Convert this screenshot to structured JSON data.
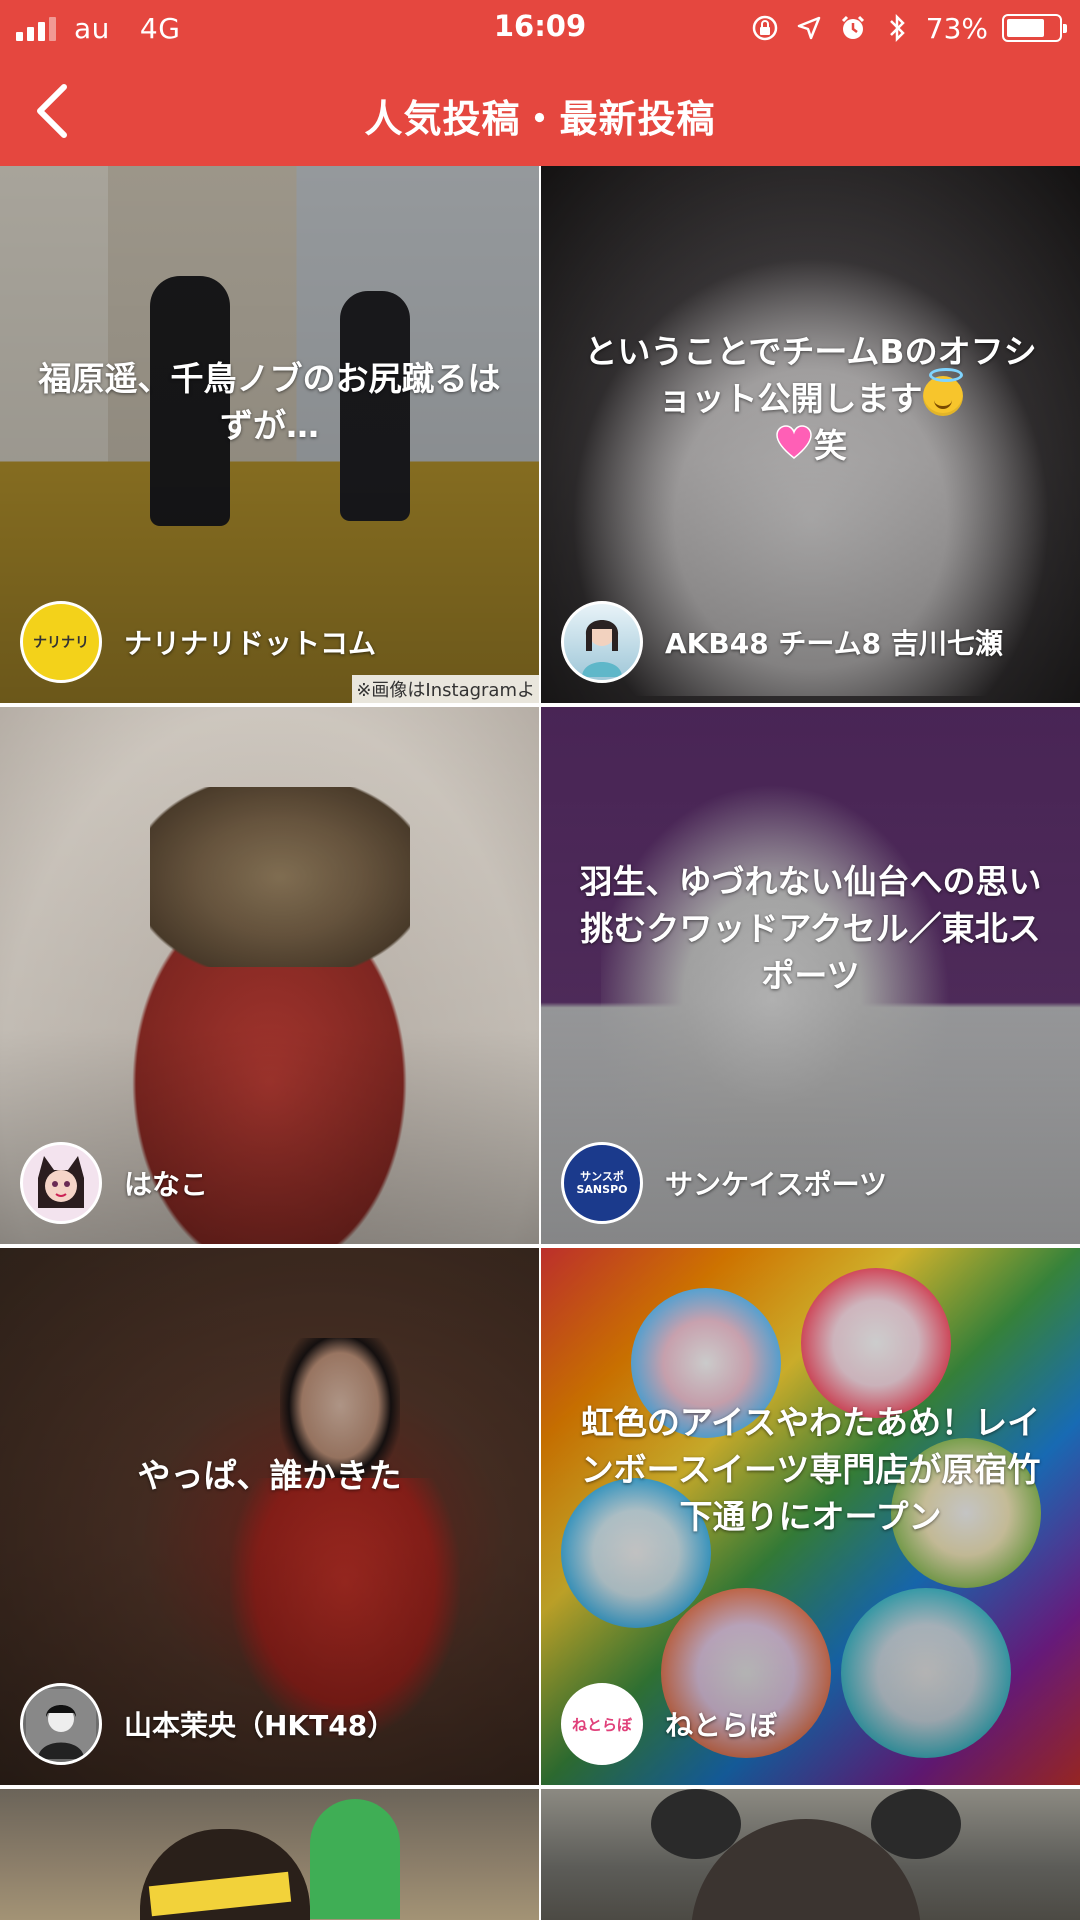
{
  "status_bar": {
    "carrier": "au",
    "network": "4G",
    "time": "16:09",
    "battery_percent": "73%",
    "battery_level": 0.73,
    "icons": [
      "rotation-lock-icon",
      "location-icon",
      "alarm-icon",
      "bluetooth-icon",
      "battery-icon"
    ]
  },
  "nav": {
    "back_icon": "chevron-left-icon",
    "title": "人気投稿・最新投稿"
  },
  "colors": {
    "header": "#e5473f",
    "text_on_card": "#ffffff"
  },
  "posts": [
    {
      "title": "福原遥、千鳥ノブのお尻蹴るはずが…",
      "author": "ナリナリドットコム",
      "avatar_text": "ナリナリ",
      "caption_note": "※画像はInstagramよ"
    },
    {
      "title_text": "ということでチームBのオフショット公開します",
      "title_tail": "笑",
      "author": "AKB48 チーム8 吉川七瀬"
    },
    {
      "title": "",
      "author": "はなこ"
    },
    {
      "title": "羽生、ゆづれない仙台への思い　挑むクワッドアクセル／東北スポーツ",
      "author": "サンケイスポーツ",
      "avatar_text": "サンスポ SANSPO"
    },
    {
      "title": "やっぱ、誰かきた",
      "author": "山本茉央（HKT48）"
    },
    {
      "title": "虹色のアイスやわたあめ！レインボースイーツ専門店が原宿竹下通りにオープン",
      "author": "ねとらぼ",
      "avatar_text": "ねとらぼ"
    }
  ]
}
